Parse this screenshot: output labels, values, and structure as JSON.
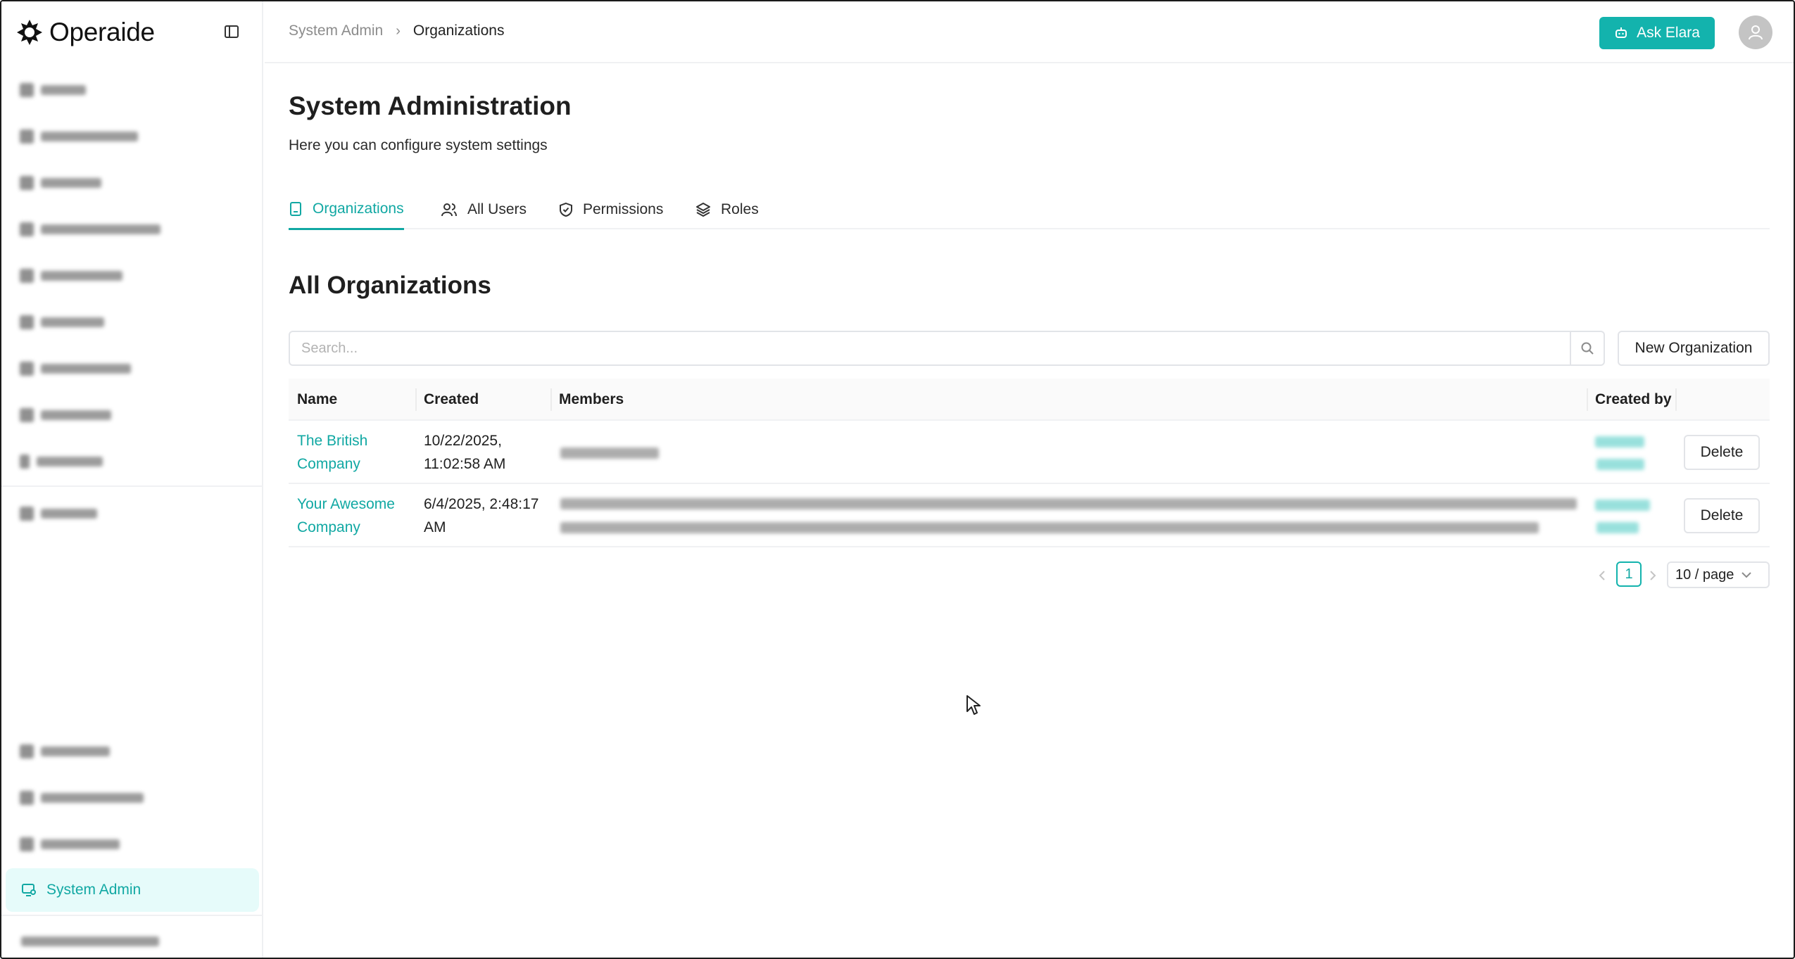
{
  "app": {
    "logo_text": "Operaide",
    "brand_color": "#13b3ad"
  },
  "sidebar": {
    "active_item": {
      "label": "System Admin",
      "icon": "monitor-settings-icon"
    }
  },
  "topbar": {
    "breadcrumb": [
      "System Admin",
      "Organizations"
    ],
    "ask_button": "Ask Elara",
    "ask_icon": "bot-icon",
    "avatar_icon": "user-icon"
  },
  "page": {
    "title": "System Administration",
    "subtitle": "Here you can configure system settings"
  },
  "tabs": [
    {
      "label": "Organizations",
      "icon": "building-icon",
      "active": true
    },
    {
      "label": "All Users",
      "icon": "users-icon",
      "active": false
    },
    {
      "label": "Permissions",
      "icon": "shield-icon",
      "active": false
    },
    {
      "label": "Roles",
      "icon": "layers-icon",
      "active": false
    }
  ],
  "section": {
    "title": "All Organizations",
    "search_placeholder": "Search...",
    "new_button": "New Organization"
  },
  "table": {
    "columns": [
      "Name",
      "Created",
      "Members",
      "Created by"
    ],
    "rows": [
      {
        "name": "The British Company",
        "created": "10/22/2025, 11:02:58 AM",
        "action": "Delete"
      },
      {
        "name": "Your Awesome Company",
        "created": "6/4/2025, 2:48:17 AM",
        "action": "Delete"
      }
    ]
  },
  "pagination": {
    "current_page": "1",
    "page_size": "10 / page"
  }
}
